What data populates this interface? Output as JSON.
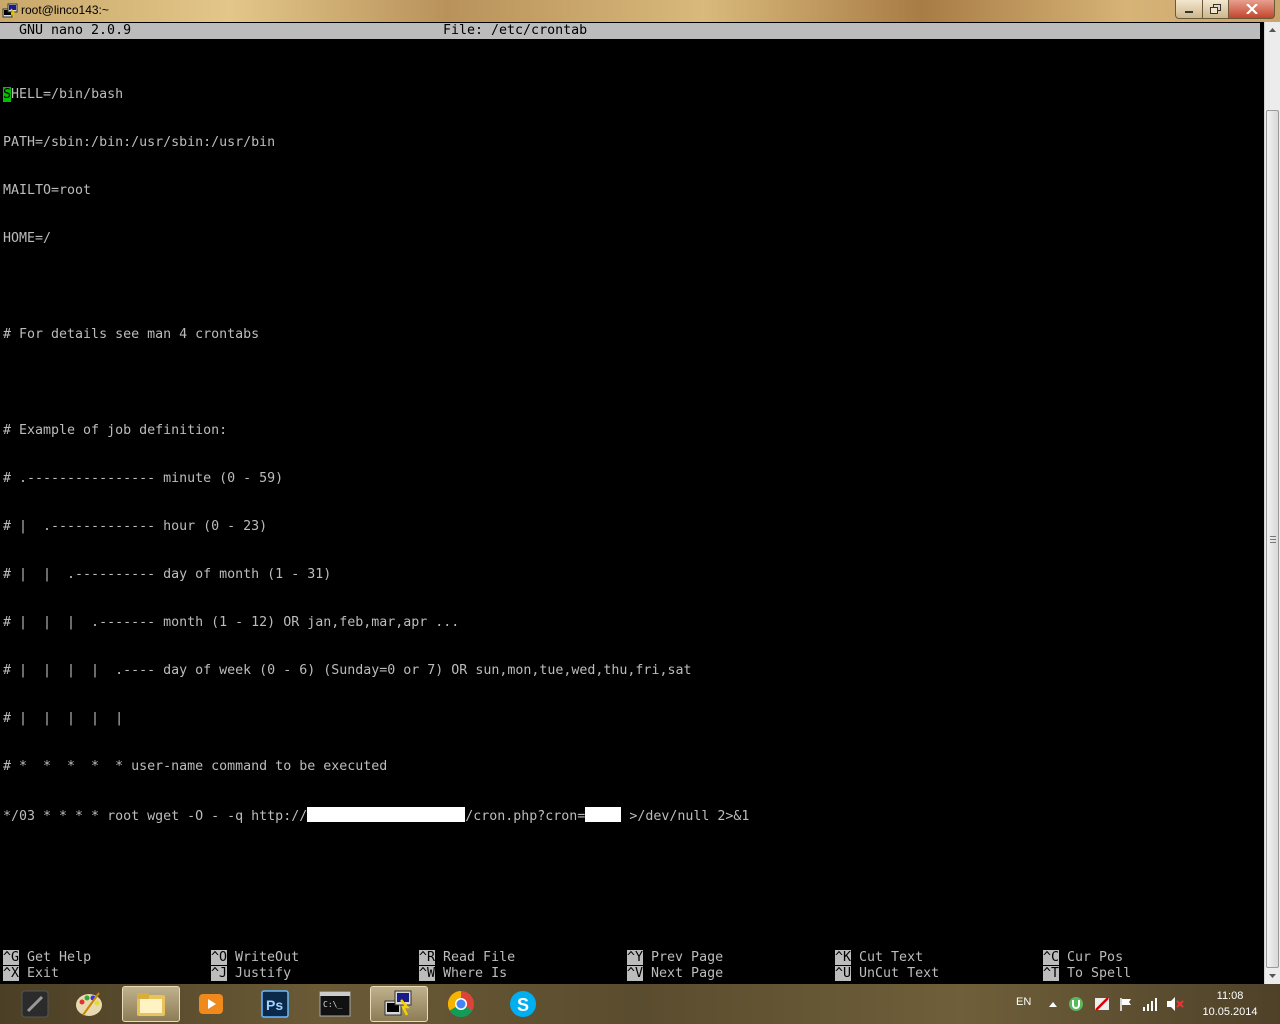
{
  "window": {
    "title": "root@linco143:~"
  },
  "nano": {
    "version": "GNU nano 2.0.9",
    "file": "File: /etc/crontab"
  },
  "editor": {
    "cursor_char": "S",
    "line1_rest": "HELL=/bin/bash",
    "lines": [
      "PATH=/sbin:/bin:/usr/sbin:/usr/bin",
      "MAILTO=root",
      "HOME=/",
      "",
      "# For details see man 4 crontabs",
      "",
      "# Example of job definition:",
      "# .---------------- minute (0 - 59)",
      "# |  .------------- hour (0 - 23)",
      "# |  |  .---------- day of month (1 - 31)",
      "# |  |  |  .------- month (1 - 12) OR jan,feb,mar,apr ...",
      "# |  |  |  |  .---- day of week (0 - 6) (Sunday=0 or 7) OR sun,mon,tue,wed,thu,fri,sat",
      "# |  |  |  |  |",
      "# *  *  *  *  * user-name command to be executed"
    ],
    "cron_part1": "*/03 * * * * root wget -O - -q http://",
    "cron_part2": "/cron.php?cron=",
    "cron_part3": " >/dev/null 2>&1"
  },
  "shortcuts": [
    {
      "key": "^G",
      "label": "Get Help"
    },
    {
      "key": "^O",
      "label": "WriteOut"
    },
    {
      "key": "^R",
      "label": "Read File"
    },
    {
      "key": "^Y",
      "label": "Prev Page"
    },
    {
      "key": "^K",
      "label": "Cut Text"
    },
    {
      "key": "^C",
      "label": "Cur Pos"
    },
    {
      "key": "^X",
      "label": "Exit"
    },
    {
      "key": "^J",
      "label": "Justify"
    },
    {
      "key": "^W",
      "label": "Where Is"
    },
    {
      "key": "^V",
      "label": "Next Page"
    },
    {
      "key": "^U",
      "label": "UnCut Text"
    },
    {
      "key": "^T",
      "label": "To Spell"
    }
  ],
  "taskbar": {
    "apps": [
      {
        "name": "dota-icon"
      },
      {
        "name": "paint-icon"
      },
      {
        "name": "explorer-icon"
      },
      {
        "name": "media-player-icon"
      },
      {
        "name": "photoshop-icon",
        "text": "Ps"
      },
      {
        "name": "cmd-icon"
      },
      {
        "name": "putty-icon"
      },
      {
        "name": "chrome-icon"
      },
      {
        "name": "skype-icon"
      }
    ],
    "language": "EN",
    "time": "11:08",
    "date": "10.05.2014"
  },
  "colors": {
    "cursor": "#00c000",
    "terminal_text": "#bcbcbc",
    "terminal_bg": "#000000"
  }
}
